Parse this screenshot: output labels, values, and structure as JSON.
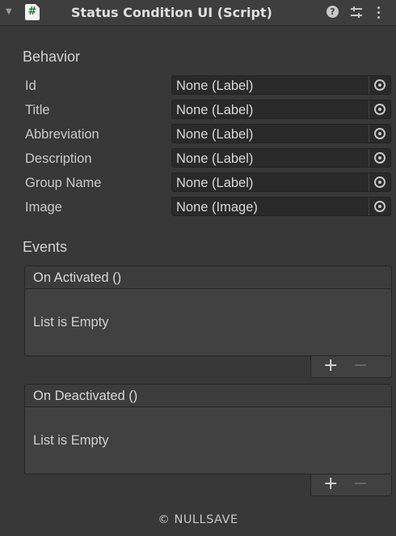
{
  "header": {
    "fold_glyph": "▼",
    "script_glyph": "#",
    "title": "Status Condition UI (Script)",
    "help_glyph": "?",
    "icons": [
      "help-icon",
      "presets-icon",
      "more-icon"
    ]
  },
  "behavior": {
    "title": "Behavior",
    "properties": [
      {
        "label": "Id",
        "value": "None (Label)"
      },
      {
        "label": "Title",
        "value": "None (Label)"
      },
      {
        "label": "Abbreviation",
        "value": "None (Label)"
      },
      {
        "label": "Description",
        "value": "None (Label)"
      },
      {
        "label": "Group Name",
        "value": "None (Label)"
      },
      {
        "label": "Image",
        "value": "None (Image)"
      }
    ]
  },
  "events": {
    "title": "Events",
    "list": [
      {
        "name": "On Activated ()",
        "empty_text": "List is Empty",
        "add": "+",
        "remove": "−"
      },
      {
        "name": "On Deactivated ()",
        "empty_text": "List is Empty",
        "add": "+",
        "remove": "−"
      }
    ]
  },
  "footer": {
    "copyright": "© NULLSAVE"
  },
  "colors": {
    "background": "#383838",
    "header": "#3e3e3e",
    "field": "#2a2a2a",
    "script_icon": "#1b7a3a"
  }
}
